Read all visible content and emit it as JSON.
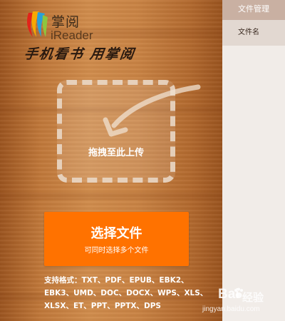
{
  "logo": {
    "name_cn": "掌阅",
    "name_en": "iReader",
    "slogan": "手机看书 用掌阅"
  },
  "dropzone": {
    "text": "拖拽至此上传"
  },
  "upload": {
    "title": "选择文件",
    "subtitle": "可同时选择多个文件"
  },
  "formats": {
    "text": "支持格式：TXT、PDF、EPUB、EBK2、\nEBK3、UMD、DOC、DOCX、WPS、XLS、\nXLSX、ET、PPT、PPTX、DPS"
  },
  "sidebar": {
    "header": "文件管理",
    "column": "文件名"
  },
  "watermark": {
    "brand": "Bai",
    "brand_cn": "经验",
    "url": "jingyan.baidu.com"
  },
  "colors": {
    "accent": "#ff7200",
    "sidebar_header": "#c9b0a2",
    "sidebar_bg": "#f1ece8"
  }
}
